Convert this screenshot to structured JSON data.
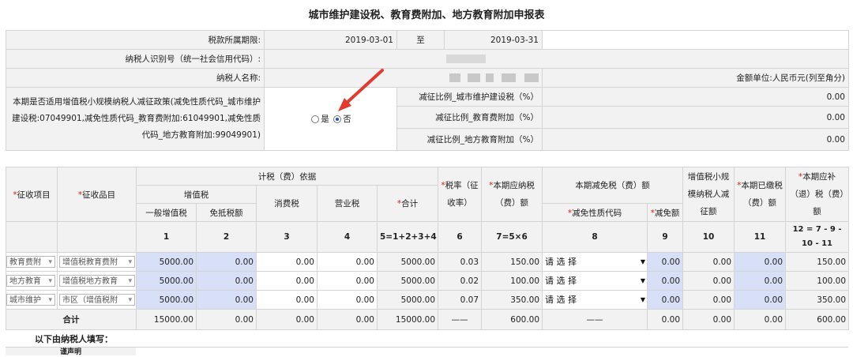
{
  "title": "城市维护建设税、教育费附加、地方教育附加申报表",
  "period": {
    "label": "税款所属期限:",
    "from": "2019-03-01",
    "to_label": "至",
    "to": "2019-03-31"
  },
  "taxpayer_id": {
    "label": "纳税人识别号（统一社会信用代码）:"
  },
  "taxpayer_name": {
    "label": "纳税人名称:",
    "unit": "金额单位:人民币元(列至角分)"
  },
  "policy": {
    "text": "本期是否适用增值税小规模纳税人减征政策(减免性质代码_城市维护建设税:07049901,减免性质代码_教育费附加:61049901,减免性质代码_地方教育附加:99049901)",
    "yes": "是",
    "no": "否",
    "ratios": [
      {
        "label": "减征比例_城市维护建设税（%）",
        "value": "0.00"
      },
      {
        "label": "减征比例_教育费附加（%）",
        "value": "0.00"
      },
      {
        "label": "减征比例_地方教育附加（%）",
        "value": "0.00"
      }
    ]
  },
  "headers": {
    "item": "征收项目",
    "subitem": "征收品目",
    "basis": "计税（费）依据",
    "vat": "增值税",
    "vat_general": "一般增值税",
    "vat_exempt": "免抵税额",
    "consumption": "消费税",
    "business": "营业税",
    "sum": "合计",
    "rate": "税率（征收率）",
    "payable": "本期应纳税（费）额",
    "reduction": "本期减免税（费）额",
    "reduction_code": "减免性质代码",
    "reduction_amt": "减免额",
    "small_scale": "增值税小规模纳税人减征额",
    "paid": "本期已缴税（费）额",
    "due": "本期应补（退）税（费）额"
  },
  "col_nums": [
    "1",
    "2",
    "3",
    "4",
    "5=1+2+3+4",
    "6",
    "7=5×6",
    "8",
    "9",
    "10",
    "11",
    "12 = 7 - 9 - 10 - 11"
  ],
  "rows": [
    {
      "item": "教育费附",
      "sub": "增值税教育费附",
      "c1": "5000.00",
      "c2": "0.00",
      "c3": "0.00",
      "c4": "0.00",
      "c5": "5000.00",
      "c6": "0.03",
      "c7": "150.00",
      "c8": "请 选 择",
      "c9": "0.00",
      "c10": "0.00",
      "c11": "0.00",
      "c12": "150.00"
    },
    {
      "item": "地方教育",
      "sub": "增值税地方教育",
      "c1": "5000.00",
      "c2": "0.00",
      "c3": "0.00",
      "c4": "0.00",
      "c5": "5000.00",
      "c6": "0.02",
      "c7": "100.00",
      "c8": "请 选 择",
      "c9": "0.00",
      "c10": "0.00",
      "c11": "0.00",
      "c12": "100.00"
    },
    {
      "item": "城市维护",
      "sub": "市区（增值税附",
      "c1": "5000.00",
      "c2": "0.00",
      "c3": "0.00",
      "c4": "0.00",
      "c5": "5000.00",
      "c6": "0.07",
      "c7": "350.00",
      "c8": "请 选 择",
      "c9": "0.00",
      "c10": "0.00",
      "c11": "0.00",
      "c12": "350.00"
    }
  ],
  "total": {
    "label": "合计",
    "c1": "15000.00",
    "c2": "0.00",
    "c3": "0.00",
    "c4": "0.00",
    "c5": "15000.00",
    "c6": "——",
    "c7": "600.00",
    "c8": "——",
    "c9": "0.00",
    "c10": "0.00",
    "c11": "0.00",
    "c12": "600.00"
  },
  "footnote": "以下由纳税人填写：",
  "footer_label": "谨声明"
}
